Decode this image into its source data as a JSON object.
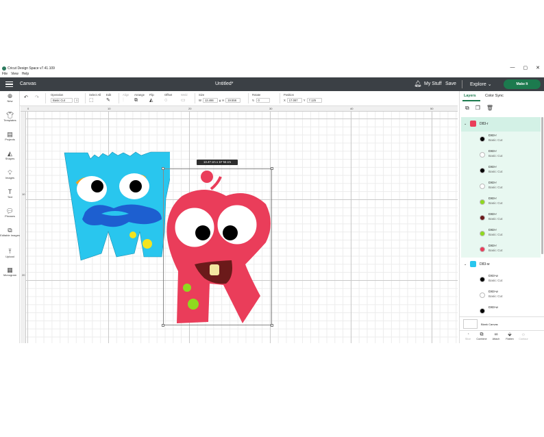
{
  "window": {
    "app_title": "Cricut Design Space  v7.41.109",
    "menu": [
      "File",
      "View",
      "Help"
    ],
    "controls": [
      "—",
      "▢",
      "✕"
    ]
  },
  "header": {
    "section": "Canvas",
    "doc_title": "Untitled*",
    "my_stuff": "My Stuff",
    "save": "Save",
    "explore": "Explore",
    "make_it": "Make It"
  },
  "toolbar": {
    "operation_label": "Operation",
    "operation_value": "Basic Cut",
    "select_all": "Select All",
    "edit": "Edit",
    "align": "Align",
    "arrange": "Arrange",
    "flip": "Flip",
    "offset": "Offset",
    "weld": "Weld",
    "size": "Size",
    "w_label": "W",
    "w_value": "13.466",
    "h_label": "H",
    "h_value": "19.556",
    "rotate": "Rotate",
    "rotate_value": "0",
    "position": "Position",
    "x_label": "X",
    "x_value": "17.067",
    "y_label": "Y",
    "y_value": "7.125"
  },
  "sidebar": [
    {
      "label": "New",
      "icon": "plus-icon"
    },
    {
      "label": "Templates",
      "icon": "shirt-icon"
    },
    {
      "label": "Projects",
      "icon": "projects-icon"
    },
    {
      "label": "Shapes",
      "icon": "shapes-icon"
    },
    {
      "label": "Images",
      "icon": "lightbulb-icon"
    },
    {
      "label": "Text",
      "icon": "text-icon"
    },
    {
      "label": "Phrases",
      "icon": "speech-bubble-icon"
    },
    {
      "label": "Editable Images",
      "icon": "editable-images-icon"
    },
    {
      "label": "Upload",
      "icon": "upload-icon"
    },
    {
      "label": "Monogram",
      "icon": "monogram-icon"
    }
  ],
  "rulers": {
    "top": [
      "0",
      "10",
      "20",
      "30",
      "40",
      "50"
    ],
    "left": [
      "10",
      "20"
    ]
  },
  "canvas": {
    "dimension_tip": "13.47  cm x 19.56  cm"
  },
  "panel": {
    "tabs": [
      "Layers",
      "Color Sync"
    ],
    "groups": [
      {
        "name": "D83-r",
        "selected": true,
        "layers": [
          {
            "name": "D83-r",
            "op": "Basic Cut",
            "color": "#000000"
          },
          {
            "name": "D83-r",
            "op": "Basic Cut",
            "color": "#ffffff"
          },
          {
            "name": "D83-r",
            "op": "Basic Cut",
            "color": "#000000"
          },
          {
            "name": "D83-r",
            "op": "Basic Cut",
            "color": "#ffffff"
          },
          {
            "name": "D83-r",
            "op": "Basic Cut",
            "color": "#8fd91f"
          },
          {
            "name": "D83-r",
            "op": "Basic Cut",
            "color": "#6b1a1a"
          },
          {
            "name": "D83-r",
            "op": "Basic Cut",
            "color": "#8fd91f"
          },
          {
            "name": "D83-r",
            "op": "Basic Cut",
            "color": "#ea3d5a"
          }
        ]
      },
      {
        "name": "D83-w",
        "selected": false,
        "layers": [
          {
            "name": "D83-w",
            "op": "Basic Cut",
            "color": "#000000"
          },
          {
            "name": "D83-w",
            "op": "Basic Cut",
            "color": "#ffffff"
          },
          {
            "name": "D83-w",
            "op": "",
            "color": "#000000"
          }
        ]
      }
    ],
    "blank_canvas": "Blank Canvas",
    "bottom": [
      "Slice",
      "Combine",
      "Attach",
      "Flatten",
      "Contour"
    ]
  },
  "colors": {
    "header_bg": "#3b4045",
    "accent": "#1c7a4e",
    "selected_group_bg": "#d3f1e6",
    "monster_r": "#ea3d5a",
    "monster_w": "#29c6ee",
    "monster_w_mouth": "#1d5fd0",
    "brow": "#f4a21a",
    "dots": "#8fd91f",
    "w_dots": "#f3e41f"
  }
}
